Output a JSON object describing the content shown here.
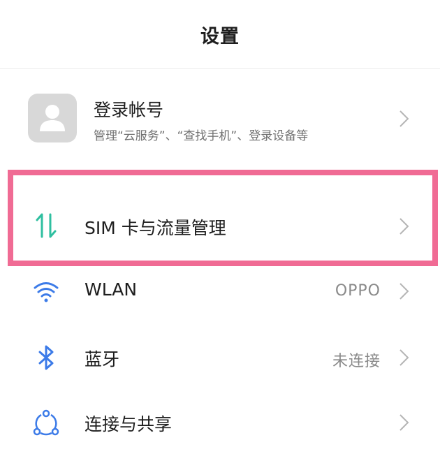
{
  "header": {
    "title": "设置"
  },
  "account": {
    "title": "登录帐号",
    "subtitle": "管理“云服务”、“查找手机”、登录设备等",
    "icon": "user-avatar-icon"
  },
  "items": [
    {
      "label": "SIM 卡与流量管理",
      "value": "",
      "icon": "sim-data-arrows-icon",
      "icon_color": "#2fbfa0"
    },
    {
      "label": "WLAN",
      "value": "OPPO",
      "icon": "wifi-icon",
      "icon_color": "#3c7be8"
    },
    {
      "label": "蓝牙",
      "value": "未连接",
      "icon": "bluetooth-icon",
      "icon_color": "#3c7be8"
    },
    {
      "label": "连接与共享",
      "value": "",
      "icon": "connection-share-icon",
      "icon_color": "#3c7be8"
    }
  ],
  "highlight_color": "#f06b94"
}
